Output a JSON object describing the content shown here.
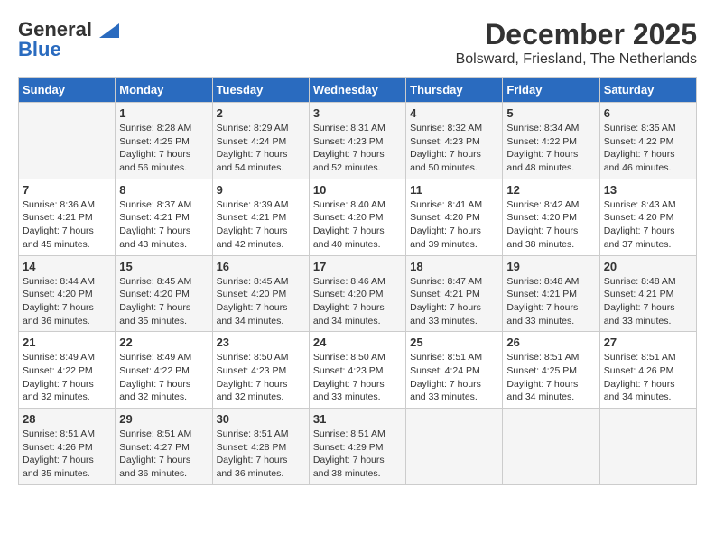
{
  "logo": {
    "line1": "General",
    "line2": "Blue"
  },
  "title": "December 2025",
  "subtitle": "Bolsward, Friesland, The Netherlands",
  "days_of_week": [
    "Sunday",
    "Monday",
    "Tuesday",
    "Wednesday",
    "Thursday",
    "Friday",
    "Saturday"
  ],
  "weeks": [
    [
      {
        "num": "",
        "detail": ""
      },
      {
        "num": "1",
        "detail": "Sunrise: 8:28 AM\nSunset: 4:25 PM\nDaylight: 7 hours\nand 56 minutes."
      },
      {
        "num": "2",
        "detail": "Sunrise: 8:29 AM\nSunset: 4:24 PM\nDaylight: 7 hours\nand 54 minutes."
      },
      {
        "num": "3",
        "detail": "Sunrise: 8:31 AM\nSunset: 4:23 PM\nDaylight: 7 hours\nand 52 minutes."
      },
      {
        "num": "4",
        "detail": "Sunrise: 8:32 AM\nSunset: 4:23 PM\nDaylight: 7 hours\nand 50 minutes."
      },
      {
        "num": "5",
        "detail": "Sunrise: 8:34 AM\nSunset: 4:22 PM\nDaylight: 7 hours\nand 48 minutes."
      },
      {
        "num": "6",
        "detail": "Sunrise: 8:35 AM\nSunset: 4:22 PM\nDaylight: 7 hours\nand 46 minutes."
      }
    ],
    [
      {
        "num": "7",
        "detail": "Sunrise: 8:36 AM\nSunset: 4:21 PM\nDaylight: 7 hours\nand 45 minutes."
      },
      {
        "num": "8",
        "detail": "Sunrise: 8:37 AM\nSunset: 4:21 PM\nDaylight: 7 hours\nand 43 minutes."
      },
      {
        "num": "9",
        "detail": "Sunrise: 8:39 AM\nSunset: 4:21 PM\nDaylight: 7 hours\nand 42 minutes."
      },
      {
        "num": "10",
        "detail": "Sunrise: 8:40 AM\nSunset: 4:20 PM\nDaylight: 7 hours\nand 40 minutes."
      },
      {
        "num": "11",
        "detail": "Sunrise: 8:41 AM\nSunset: 4:20 PM\nDaylight: 7 hours\nand 39 minutes."
      },
      {
        "num": "12",
        "detail": "Sunrise: 8:42 AM\nSunset: 4:20 PM\nDaylight: 7 hours\nand 38 minutes."
      },
      {
        "num": "13",
        "detail": "Sunrise: 8:43 AM\nSunset: 4:20 PM\nDaylight: 7 hours\nand 37 minutes."
      }
    ],
    [
      {
        "num": "14",
        "detail": "Sunrise: 8:44 AM\nSunset: 4:20 PM\nDaylight: 7 hours\nand 36 minutes."
      },
      {
        "num": "15",
        "detail": "Sunrise: 8:45 AM\nSunset: 4:20 PM\nDaylight: 7 hours\nand 35 minutes."
      },
      {
        "num": "16",
        "detail": "Sunrise: 8:45 AM\nSunset: 4:20 PM\nDaylight: 7 hours\nand 34 minutes."
      },
      {
        "num": "17",
        "detail": "Sunrise: 8:46 AM\nSunset: 4:20 PM\nDaylight: 7 hours\nand 34 minutes."
      },
      {
        "num": "18",
        "detail": "Sunrise: 8:47 AM\nSunset: 4:21 PM\nDaylight: 7 hours\nand 33 minutes."
      },
      {
        "num": "19",
        "detail": "Sunrise: 8:48 AM\nSunset: 4:21 PM\nDaylight: 7 hours\nand 33 minutes."
      },
      {
        "num": "20",
        "detail": "Sunrise: 8:48 AM\nSunset: 4:21 PM\nDaylight: 7 hours\nand 33 minutes."
      }
    ],
    [
      {
        "num": "21",
        "detail": "Sunrise: 8:49 AM\nSunset: 4:22 PM\nDaylight: 7 hours\nand 32 minutes."
      },
      {
        "num": "22",
        "detail": "Sunrise: 8:49 AM\nSunset: 4:22 PM\nDaylight: 7 hours\nand 32 minutes."
      },
      {
        "num": "23",
        "detail": "Sunrise: 8:50 AM\nSunset: 4:23 PM\nDaylight: 7 hours\nand 32 minutes."
      },
      {
        "num": "24",
        "detail": "Sunrise: 8:50 AM\nSunset: 4:23 PM\nDaylight: 7 hours\nand 33 minutes."
      },
      {
        "num": "25",
        "detail": "Sunrise: 8:51 AM\nSunset: 4:24 PM\nDaylight: 7 hours\nand 33 minutes."
      },
      {
        "num": "26",
        "detail": "Sunrise: 8:51 AM\nSunset: 4:25 PM\nDaylight: 7 hours\nand 34 minutes."
      },
      {
        "num": "27",
        "detail": "Sunrise: 8:51 AM\nSunset: 4:26 PM\nDaylight: 7 hours\nand 34 minutes."
      }
    ],
    [
      {
        "num": "28",
        "detail": "Sunrise: 8:51 AM\nSunset: 4:26 PM\nDaylight: 7 hours\nand 35 minutes."
      },
      {
        "num": "29",
        "detail": "Sunrise: 8:51 AM\nSunset: 4:27 PM\nDaylight: 7 hours\nand 36 minutes."
      },
      {
        "num": "30",
        "detail": "Sunrise: 8:51 AM\nSunset: 4:28 PM\nDaylight: 7 hours\nand 36 minutes."
      },
      {
        "num": "31",
        "detail": "Sunrise: 8:51 AM\nSunset: 4:29 PM\nDaylight: 7 hours\nand 38 minutes."
      },
      {
        "num": "",
        "detail": ""
      },
      {
        "num": "",
        "detail": ""
      },
      {
        "num": "",
        "detail": ""
      }
    ]
  ]
}
